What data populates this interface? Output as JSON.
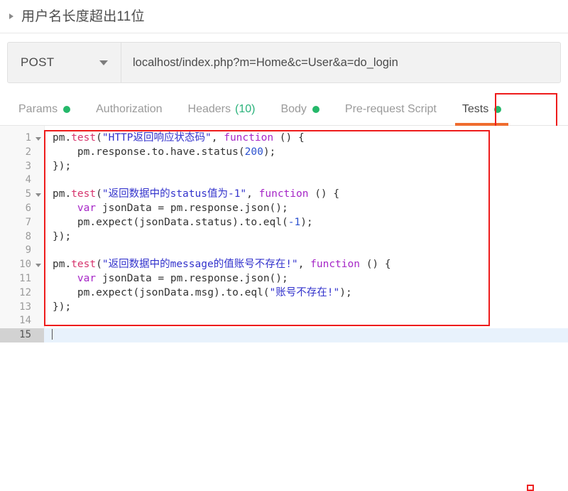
{
  "header": {
    "collapse_icon": "triangle-right-icon",
    "request_title": "用户名长度超出11位"
  },
  "request_bar": {
    "method": "POST",
    "method_caret_icon": "chevron-down-icon",
    "url": "localhost/index.php?m=Home&c=User&a=do_login",
    "url_placeholder": "Enter request URL"
  },
  "tabs": [
    {
      "label": "Params",
      "dot": true,
      "count": "",
      "active": false
    },
    {
      "label": "Authorization",
      "dot": false,
      "count": "",
      "active": false
    },
    {
      "label": "Headers",
      "dot": false,
      "count": "(10)",
      "active": false
    },
    {
      "label": "Body",
      "dot": true,
      "count": "",
      "active": false
    },
    {
      "label": "Pre-request Script",
      "dot": false,
      "count": "",
      "active": false
    },
    {
      "label": "Tests",
      "dot": true,
      "count": "",
      "active": true
    }
  ],
  "editor": {
    "active_line": 15,
    "line_numbers": [
      "1",
      "2",
      "3",
      "4",
      "5",
      "6",
      "7",
      "8",
      "9",
      "10",
      "11",
      "12",
      "13",
      "14",
      "15"
    ],
    "fold_lines": [
      1,
      5,
      10
    ],
    "lines": [
      {
        "n": "1",
        "text": "pm.test(\"HTTP返回响应状态码\", function () {"
      },
      {
        "n": "2",
        "text": "    pm.response.to.have.status(200);"
      },
      {
        "n": "3",
        "text": "});"
      },
      {
        "n": "4",
        "text": ""
      },
      {
        "n": "5",
        "text": "pm.test(\"返回数据中的status值为-1\", function () {"
      },
      {
        "n": "6",
        "text": "    var jsonData = pm.response.json();"
      },
      {
        "n": "7",
        "text": "    pm.expect(jsonData.status).to.eql(-1);"
      },
      {
        "n": "8",
        "text": "});"
      },
      {
        "n": "9",
        "text": ""
      },
      {
        "n": "10",
        "text": "pm.test(\"返回数据中的message的值账号不存在!\", function () {"
      },
      {
        "n": "11",
        "text": "    var jsonData = pm.response.json();"
      },
      {
        "n": "12",
        "text": "    pm.expect(jsonData.msg).to.eql(\"账号不存在!\");"
      },
      {
        "n": "13",
        "text": "});"
      },
      {
        "n": "14",
        "text": ""
      },
      {
        "n": "15",
        "text": ""
      }
    ]
  },
  "annotations": {
    "tests_tab_box_color": "#ee1c1c",
    "code_box_color": "#ee1c1c",
    "marker_color": "#ee2222",
    "active_tab_underline_color": "#ef6c2e",
    "dot_color": "#25b86a"
  }
}
